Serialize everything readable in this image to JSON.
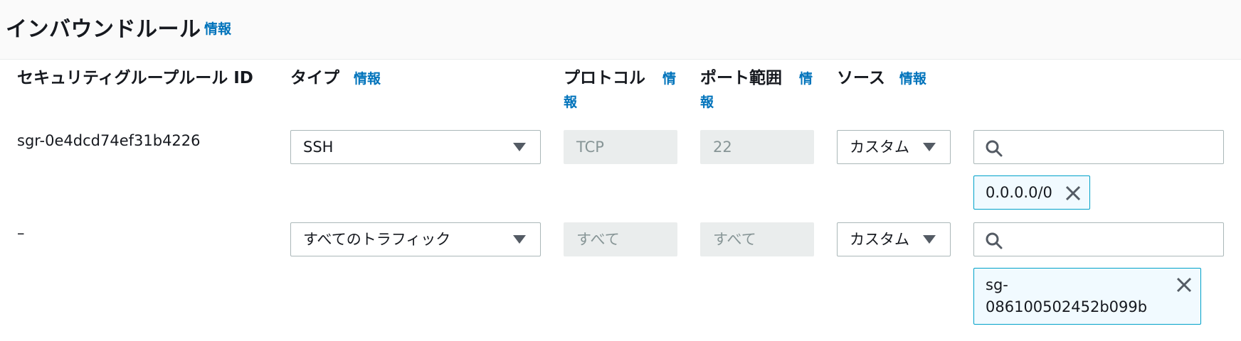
{
  "header": {
    "title": "インバウンドルール",
    "info": "情報"
  },
  "columns": {
    "rule_id": "セキュリティグループルール ID",
    "type": "タイプ",
    "protocol": "プロトコル",
    "port_range": "ポート範囲",
    "source": "ソース",
    "info": "情報"
  },
  "rows": [
    {
      "rule_id": "sgr-0e4dcd74ef31b4226",
      "type": "SSH",
      "protocol": "TCP",
      "port": "22",
      "source": "カスタム",
      "token": "0.0.0.0/0"
    },
    {
      "rule_id": "–",
      "type": "すべてのトラフィック",
      "protocol": "すべて",
      "port": "すべて",
      "source": "カスタム",
      "token_line1": "sg-",
      "token_line2": "086100502452b099b"
    }
  ]
}
